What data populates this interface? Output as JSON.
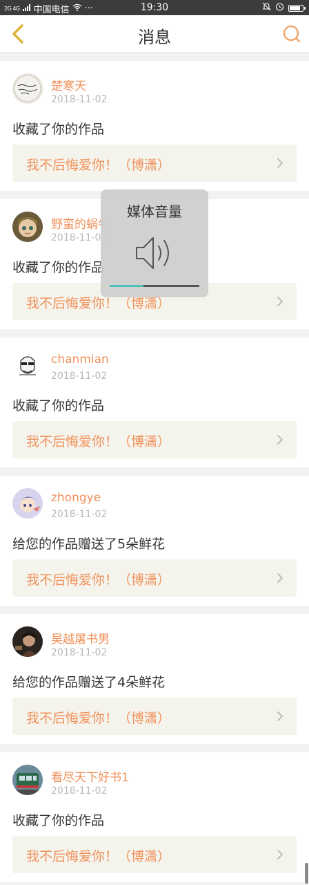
{
  "status_bar": {
    "signal_text": "2G 4G",
    "carrier": "中国电信",
    "more": "···",
    "time": "19:30",
    "battery_level": 0.85
  },
  "header": {
    "title": "消息"
  },
  "messages": [
    {
      "username": "楚寒天",
      "date": "2018-11-02",
      "action": "收藏了你的作品",
      "work_title": "我不后悔爱你！（博潇）",
      "avatar_icon": "avatar-handwriting-plate"
    },
    {
      "username": "野蛮的蜗牛",
      "date": "2018-11-02",
      "action": "收藏了你的作品",
      "work_title": "我不后悔爱你！（博潇）",
      "avatar_icon": "avatar-doll"
    },
    {
      "username": "chanmian",
      "date": "2018-11-02",
      "action": "收藏了你的作品",
      "work_title": "我不后悔爱你！（博潇）",
      "avatar_icon": "avatar-sketch-face"
    },
    {
      "username": "zhongye",
      "date": "2018-11-02",
      "action": "给您的作品赠送了5朵鲜花",
      "work_title": "我不后悔爱你！（博潇）",
      "avatar_icon": "avatar-anime"
    },
    {
      "username": "吴越屠书男",
      "date": "2018-11-02",
      "action": "给您的作品赠送了4朵鲜花",
      "work_title": "我不后悔爱你！（博潇）",
      "avatar_icon": "avatar-dark-portrait"
    },
    {
      "username": "看尽天下好书1",
      "date": "2018-11-02",
      "action": "收藏了你的作品",
      "work_title": "我不后悔爱你！（博潇）",
      "avatar_icon": "avatar-train"
    }
  ],
  "volume_overlay": {
    "title": "媒体音量",
    "level": 0.38
  },
  "colors": {
    "accent": "#f0905a",
    "back_icon": "#d9b23a",
    "search_icon": "#f0a060",
    "volume_fill": "#4fc1b8"
  }
}
